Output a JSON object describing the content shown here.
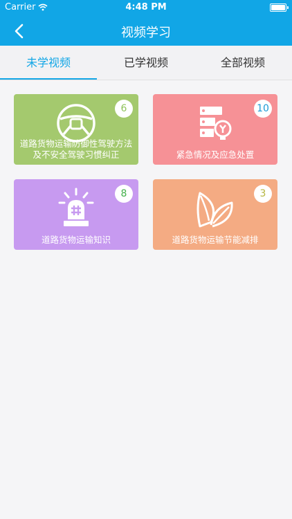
{
  "status_bar": {
    "carrier": "Carrier",
    "time": "4:48 PM"
  },
  "nav": {
    "title": "视频学习"
  },
  "tabs": [
    {
      "label": "未学视频",
      "active": true
    },
    {
      "label": "已学视频",
      "active": false
    },
    {
      "label": "全部视频",
      "active": false
    }
  ],
  "cards": [
    {
      "label": "道路货物运输防御性驾驶方法及不安全驾驶习惯纠正",
      "count": "6",
      "color": "#a4c96e",
      "count_color": "#8fc25a",
      "icon": "steering-wheel-icon"
    },
    {
      "label": "紧急情况及应急处置",
      "count": "10",
      "color": "#f69196",
      "count_color": "#1a9ad6",
      "icon": "emergency-server-icon"
    },
    {
      "label": "道路货物运输知识",
      "count": "8",
      "color": "#c79af0",
      "count_color": "#43b04a",
      "icon": "siren-icon"
    },
    {
      "label": "道路货物运输节能减排",
      "count": "3",
      "color": "#f4ab83",
      "count_color": "#b5b53e",
      "icon": "leaf-icon"
    }
  ]
}
